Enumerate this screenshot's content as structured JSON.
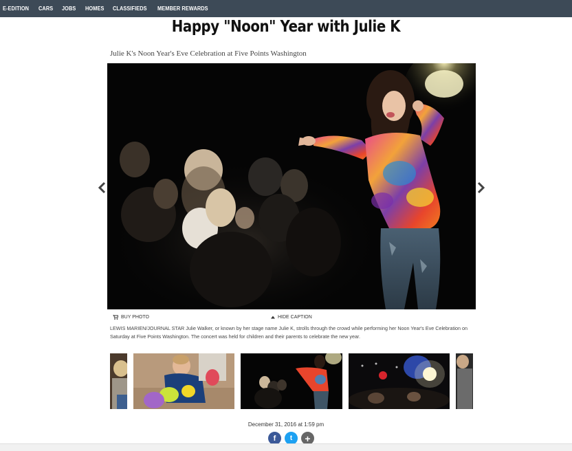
{
  "nav": {
    "items": [
      "E-EDITION",
      "CARS",
      "JOBS",
      "HOMES",
      "CLASSIFIEDS",
      "MEMBER REWARDS"
    ]
  },
  "gallery": {
    "title": "Happy \"Noon\" Year with Julie K",
    "subtitle": "Julie K's Noon Year's Eve Celebration at Five Points Washington",
    "buy_photo": "BUY PHOTO",
    "hide_caption": "HIDE CAPTION",
    "caption": "LEWIS MARIEN/JOURNAL STAR Julie Walker, or known by her stage name Julie K, strolls through the crowd while performing her Noon Year's Eve Celebration on Saturday at Five Points Washington. The concert was held for children and their parents to celebrate the new year.",
    "date": "December 31, 2016 at 1:59 pm"
  },
  "share": {
    "facebook": "f",
    "twitter": "t",
    "more": "+"
  },
  "icons": {
    "prev": "chevron-left-icon",
    "next": "chevron-right-icon",
    "cart": "cart-icon",
    "caret": "caret-up-icon"
  },
  "colors": {
    "nav_bg": "#3d4a57",
    "facebook": "#3b5998",
    "twitter": "#1da1f2",
    "more": "#666666"
  }
}
